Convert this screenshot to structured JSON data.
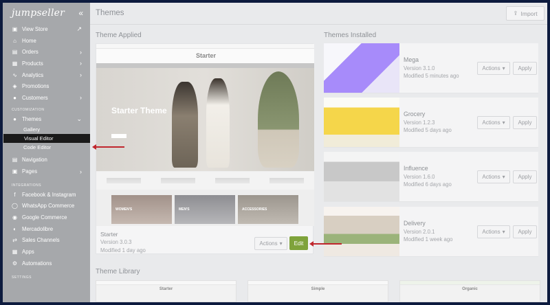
{
  "sidebar": {
    "logo": "jumpseller",
    "collapse_icon": "«",
    "items_top": [
      {
        "label": "View Store",
        "icon": "store-icon",
        "chevron": "↗"
      },
      {
        "label": "Home",
        "icon": "home-icon",
        "chevron": ""
      },
      {
        "label": "Orders",
        "icon": "orders-icon",
        "chevron": "›"
      },
      {
        "label": "Products",
        "icon": "products-icon",
        "chevron": "›"
      },
      {
        "label": "Analytics",
        "icon": "analytics-icon",
        "chevron": "›"
      },
      {
        "label": "Promotions",
        "icon": "promotions-icon",
        "chevron": ""
      },
      {
        "label": "Customers",
        "icon": "customers-icon",
        "chevron": "›"
      }
    ],
    "customization_label": "CUSTOMIZATION",
    "themes_label": "Themes",
    "themes_chevron": "⌄",
    "themes_sub": [
      "Gallery",
      "Visual Editor",
      "Code Editor"
    ],
    "items_mid": [
      {
        "label": "Navigation",
        "icon": "navigation-icon",
        "chevron": ""
      },
      {
        "label": "Pages",
        "icon": "pages-icon",
        "chevron": "›"
      }
    ],
    "integrations_label": "INTEGRATIONS",
    "items_integrations": [
      {
        "label": "Facebook & Instagram",
        "icon": "facebook-icon"
      },
      {
        "label": "WhatsApp Commerce",
        "icon": "whatsapp-icon"
      },
      {
        "label": "Google Commerce",
        "icon": "google-icon"
      },
      {
        "label": "Mercadolibre",
        "icon": "mercadolibre-icon"
      },
      {
        "label": "Sales Channels",
        "icon": "sales-channels-icon"
      },
      {
        "label": "Apps",
        "icon": "apps-icon"
      },
      {
        "label": "Automations",
        "icon": "automations-icon"
      }
    ],
    "settings_label": "SETTINGS"
  },
  "header": {
    "title": "Themes",
    "import_label": "Import",
    "import_icon": "import-icon"
  },
  "applied": {
    "section_title": "Theme Applied",
    "preview_brand": "Starter",
    "preview_hero_title": "Starter Theme",
    "preview_tiles": [
      "WOMEN'S",
      "MEN'S",
      "ACCESSORIES"
    ],
    "name": "Starter",
    "version": "Version 3.0.3",
    "modified": "Modified 1 day ago",
    "actions_label": "Actions",
    "edit_label": "Edit"
  },
  "installed": {
    "section_title": "Themes Installed",
    "themes": [
      {
        "name": "Mega",
        "version": "Version 3.1.0",
        "modified": "Modified 5 minutes ago",
        "accent": "#8b5cf6"
      },
      {
        "name": "Grocery",
        "version": "Version 1.2.3",
        "modified": "Modified 5 days ago",
        "accent": "#f3c531"
      },
      {
        "name": "Influence",
        "version": "Version 1.6.0",
        "modified": "Modified 6 days ago",
        "accent": "#9a9a9a"
      },
      {
        "name": "Delivery",
        "version": "Version 2.0.1",
        "modified": "Modified 1 week ago",
        "accent": "#e0583c"
      }
    ],
    "actions_label": "Actions",
    "apply_label": "Apply"
  },
  "library": {
    "section_title": "Theme Library",
    "themes": [
      "Starter",
      "Simple",
      "Organic"
    ]
  },
  "colors": {
    "edit_button": "#7fa33b",
    "annotation_arrow": "#c0262d",
    "sidebar_active": "#1a1a1a"
  }
}
